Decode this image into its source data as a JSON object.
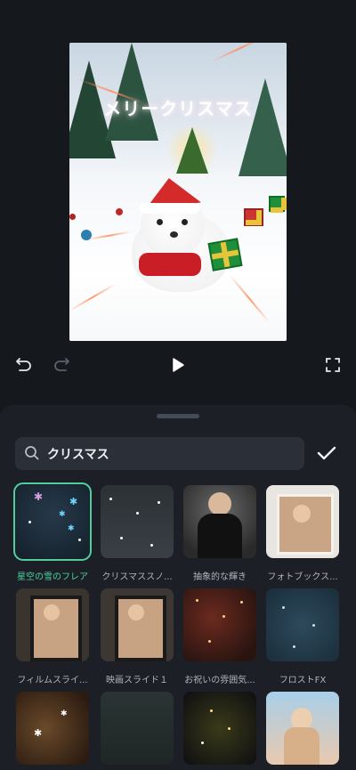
{
  "preview": {
    "overlay_text": "メリークリスマス"
  },
  "playback": {
    "undo_icon": "undo-icon",
    "redo_icon": "redo-icon",
    "play_icon": "play-icon",
    "fullscreen_icon": "fullscreen-icon"
  },
  "search": {
    "query": "クリスマス",
    "icon": "search-icon",
    "confirm_icon": "check-icon"
  },
  "effects": [
    {
      "label": "星空の雪のフレア",
      "selected": true
    },
    {
      "label": "クリスマススノ...",
      "selected": false
    },
    {
      "label": "抽象的な輝き",
      "selected": false
    },
    {
      "label": "フォトブックス...",
      "selected": false
    },
    {
      "label": "フィルムスライ...",
      "selected": false
    },
    {
      "label": "映画スライド１",
      "selected": false
    },
    {
      "label": "お祝いの雰囲気...",
      "selected": false
    },
    {
      "label": "フロストFX",
      "selected": false
    },
    {
      "label": "",
      "selected": false
    },
    {
      "label": "",
      "selected": false
    },
    {
      "label": "",
      "selected": false
    },
    {
      "label": "",
      "selected": false
    }
  ],
  "colors": {
    "accent": "#4ecfa0",
    "background": "#15181d",
    "sheet": "#1c2026"
  }
}
